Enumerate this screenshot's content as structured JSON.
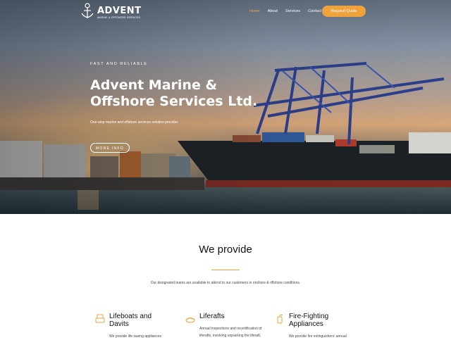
{
  "brand": {
    "name": "ADVENT",
    "tagline": "MARINE & OFFSHORE SERVICES"
  },
  "nav": {
    "items": [
      {
        "label": "Home",
        "active": true
      },
      {
        "label": "About",
        "active": false
      },
      {
        "label": "Services",
        "active": false
      },
      {
        "label": "Contact",
        "active": false
      }
    ],
    "cta_label": "Request Quote"
  },
  "hero": {
    "eyebrow": "FAST AND RELIABLE",
    "title_line1": "Advent Marine &",
    "title_line2": "Offshore Services Ltd.",
    "subtitle": "One-stop marine and offshore services solution provider.",
    "button_label": "MORE INFO"
  },
  "provide": {
    "title": "We provide",
    "description": "Our designated teams are available to attend to our customers in onshore & offshore conditions."
  },
  "services": [
    {
      "title_line1": "Lifeboats and",
      "title_line2": "Davits",
      "text_line1": "We provide life saving appliances",
      "text_line2": "",
      "icon": "lifeboat-icon"
    },
    {
      "title_line1": "Liferafts",
      "title_line2": "",
      "text_line1": "Annual inspections and recertification of",
      "text_line2": "liferafts, involving unpacking the liferaft,",
      "icon": "liferaft-icon"
    },
    {
      "title_line1": "Fire-Fighting",
      "title_line2": "Appliances",
      "text_line1": "We provide fire extinguishers' annual",
      "text_line2": "",
      "icon": "fire-extinguisher-icon"
    }
  ],
  "colors": {
    "accent": "#f0a23c",
    "white": "#ffffff",
    "heading": "#111111"
  }
}
